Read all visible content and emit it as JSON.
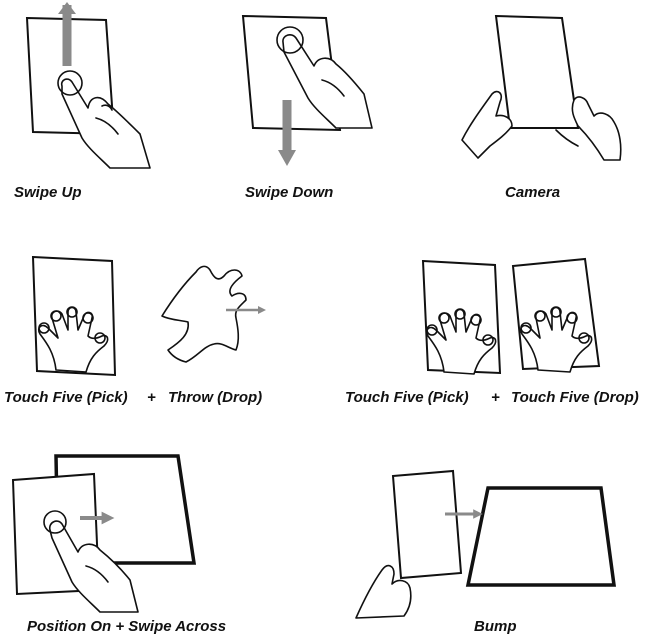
{
  "gestures": {
    "swipe_up": "Swipe Up",
    "swipe_down": "Swipe Down",
    "camera": "Camera",
    "touch_five_pick_left": "Touch Five (Pick)",
    "plus_left": "+",
    "throw_drop": "Throw (Drop)",
    "touch_five_pick_right": "Touch Five (Pick)",
    "plus_right": "+",
    "touch_five_drop": "Touch Five (Drop)",
    "position_on_swipe_across": "Position On + Swipe Across",
    "bump": "Bump"
  },
  "colors": {
    "arrow": "#8a8a8a",
    "outline": "#111111",
    "background": "#ffffff"
  }
}
